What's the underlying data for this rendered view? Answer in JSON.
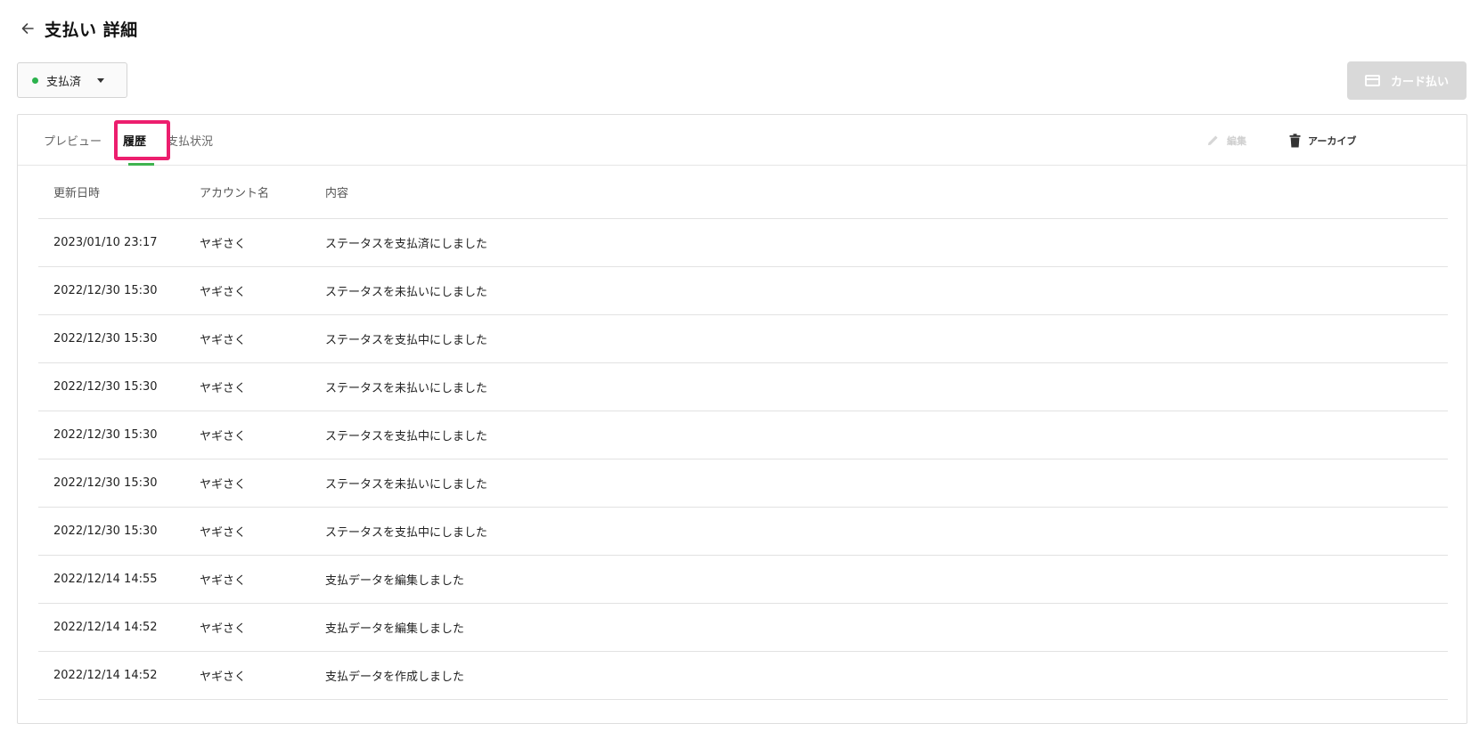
{
  "header": {
    "title": "支払い 詳細"
  },
  "status": {
    "label": "支払済",
    "color": "#2bb24c"
  },
  "card_pay": {
    "label": "カード払い"
  },
  "tabs": [
    {
      "label": "プレビュー"
    },
    {
      "label": "履歴"
    },
    {
      "label": "支払状況"
    }
  ],
  "toolbar": {
    "edit_label": "編集",
    "archive_label": "アーカイブ"
  },
  "table": {
    "headers": {
      "date": "更新日時",
      "account": "アカウント名",
      "content": "内容"
    },
    "rows": [
      {
        "date": "2023/01/10 23:17",
        "account": "ヤギさく",
        "content": "ステータスを支払済にしました"
      },
      {
        "date": "2022/12/30 15:30",
        "account": "ヤギさく",
        "content": "ステータスを未払いにしました"
      },
      {
        "date": "2022/12/30 15:30",
        "account": "ヤギさく",
        "content": "ステータスを支払中にしました"
      },
      {
        "date": "2022/12/30 15:30",
        "account": "ヤギさく",
        "content": "ステータスを未払いにしました"
      },
      {
        "date": "2022/12/30 15:30",
        "account": "ヤギさく",
        "content": "ステータスを支払中にしました"
      },
      {
        "date": "2022/12/30 15:30",
        "account": "ヤギさく",
        "content": "ステータスを未払いにしました"
      },
      {
        "date": "2022/12/30 15:30",
        "account": "ヤギさく",
        "content": "ステータスを支払中にしました"
      },
      {
        "date": "2022/12/14 14:55",
        "account": "ヤギさく",
        "content": "支払データを編集しました"
      },
      {
        "date": "2022/12/14 14:52",
        "account": "ヤギさく",
        "content": "支払データを編集しました"
      },
      {
        "date": "2022/12/14 14:52",
        "account": "ヤギさく",
        "content": "支払データを作成しました"
      }
    ]
  }
}
